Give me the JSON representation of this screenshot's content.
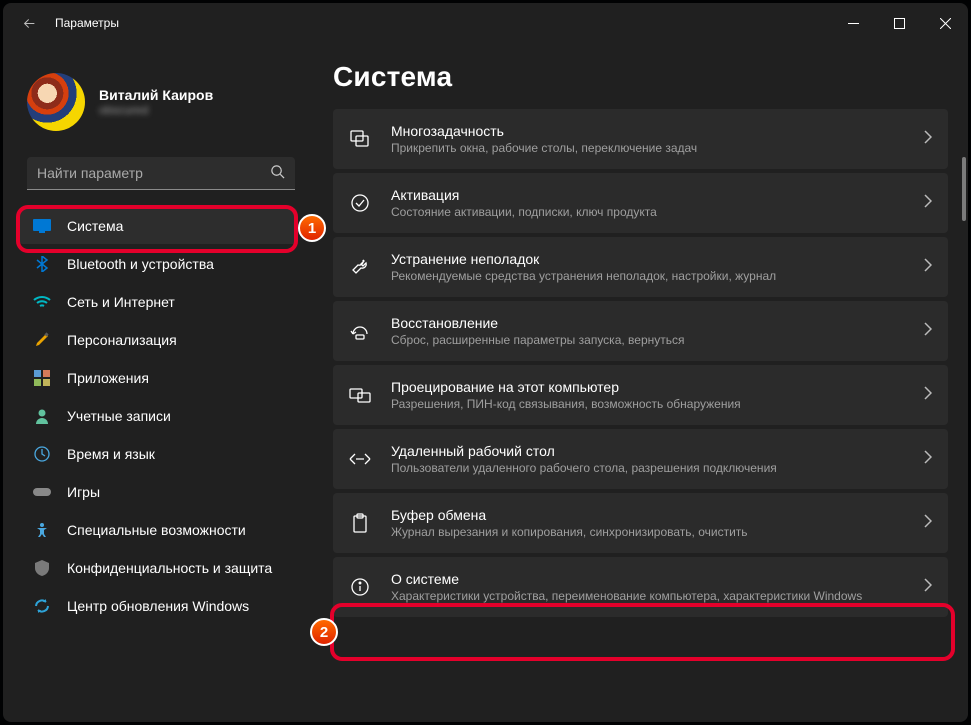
{
  "window": {
    "title": "Параметры"
  },
  "profile": {
    "name": "Виталий Каиров",
    "email": "obscured"
  },
  "search": {
    "placeholder": "Найти параметр"
  },
  "sidebar": {
    "items": [
      {
        "label": "Система",
        "icon": "display-icon",
        "active": true
      },
      {
        "label": "Bluetooth и устройства",
        "icon": "bluetooth-icon",
        "active": false
      },
      {
        "label": "Сеть и Интернет",
        "icon": "wifi-icon",
        "active": false
      },
      {
        "label": "Персонализация",
        "icon": "brush-icon",
        "active": false
      },
      {
        "label": "Приложения",
        "icon": "apps-icon",
        "active": false
      },
      {
        "label": "Учетные записи",
        "icon": "person-icon",
        "active": false
      },
      {
        "label": "Время и язык",
        "icon": "globe-clock-icon",
        "active": false
      },
      {
        "label": "Игры",
        "icon": "gamepad-icon",
        "active": false
      },
      {
        "label": "Специальные возможности",
        "icon": "accessibility-icon",
        "active": false
      },
      {
        "label": "Конфиденциальность и защита",
        "icon": "shield-icon",
        "active": false
      },
      {
        "label": "Центр обновления Windows",
        "icon": "update-icon",
        "active": false
      }
    ]
  },
  "main": {
    "heading": "Система",
    "tiles": [
      {
        "title": "Многозадачность",
        "sub": "Прикрепить окна, рабочие столы, переключение задач",
        "icon": "multitask-icon"
      },
      {
        "title": "Активация",
        "sub": "Состояние активации, подписки, ключ продукта",
        "icon": "check-circle-icon"
      },
      {
        "title": "Устранение неполадок",
        "sub": "Рекомендуемые средства устранения неполадок, настройки, журнал",
        "icon": "wrench-icon"
      },
      {
        "title": "Восстановление",
        "sub": "Сброс, расширенные параметры запуска, вернуться",
        "icon": "recovery-icon"
      },
      {
        "title": "Проецирование на этот компьютер",
        "sub": "Разрешения, ПИН-код связывания, возможность обнаружения",
        "icon": "project-icon"
      },
      {
        "title": "Удаленный рабочий стол",
        "sub": "Пользователи удаленного рабочего стола, разрешения подключения",
        "icon": "remote-icon"
      },
      {
        "title": "Буфер обмена",
        "sub": "Журнал вырезания и копирования, синхронизировать, очистить",
        "icon": "clipboard-icon"
      },
      {
        "title": "О системе",
        "sub": "Характеристики устройства, переименование компьютера, характеристики Windows",
        "icon": "info-icon"
      }
    ]
  },
  "annotations": {
    "step1": "1",
    "step2": "2"
  }
}
